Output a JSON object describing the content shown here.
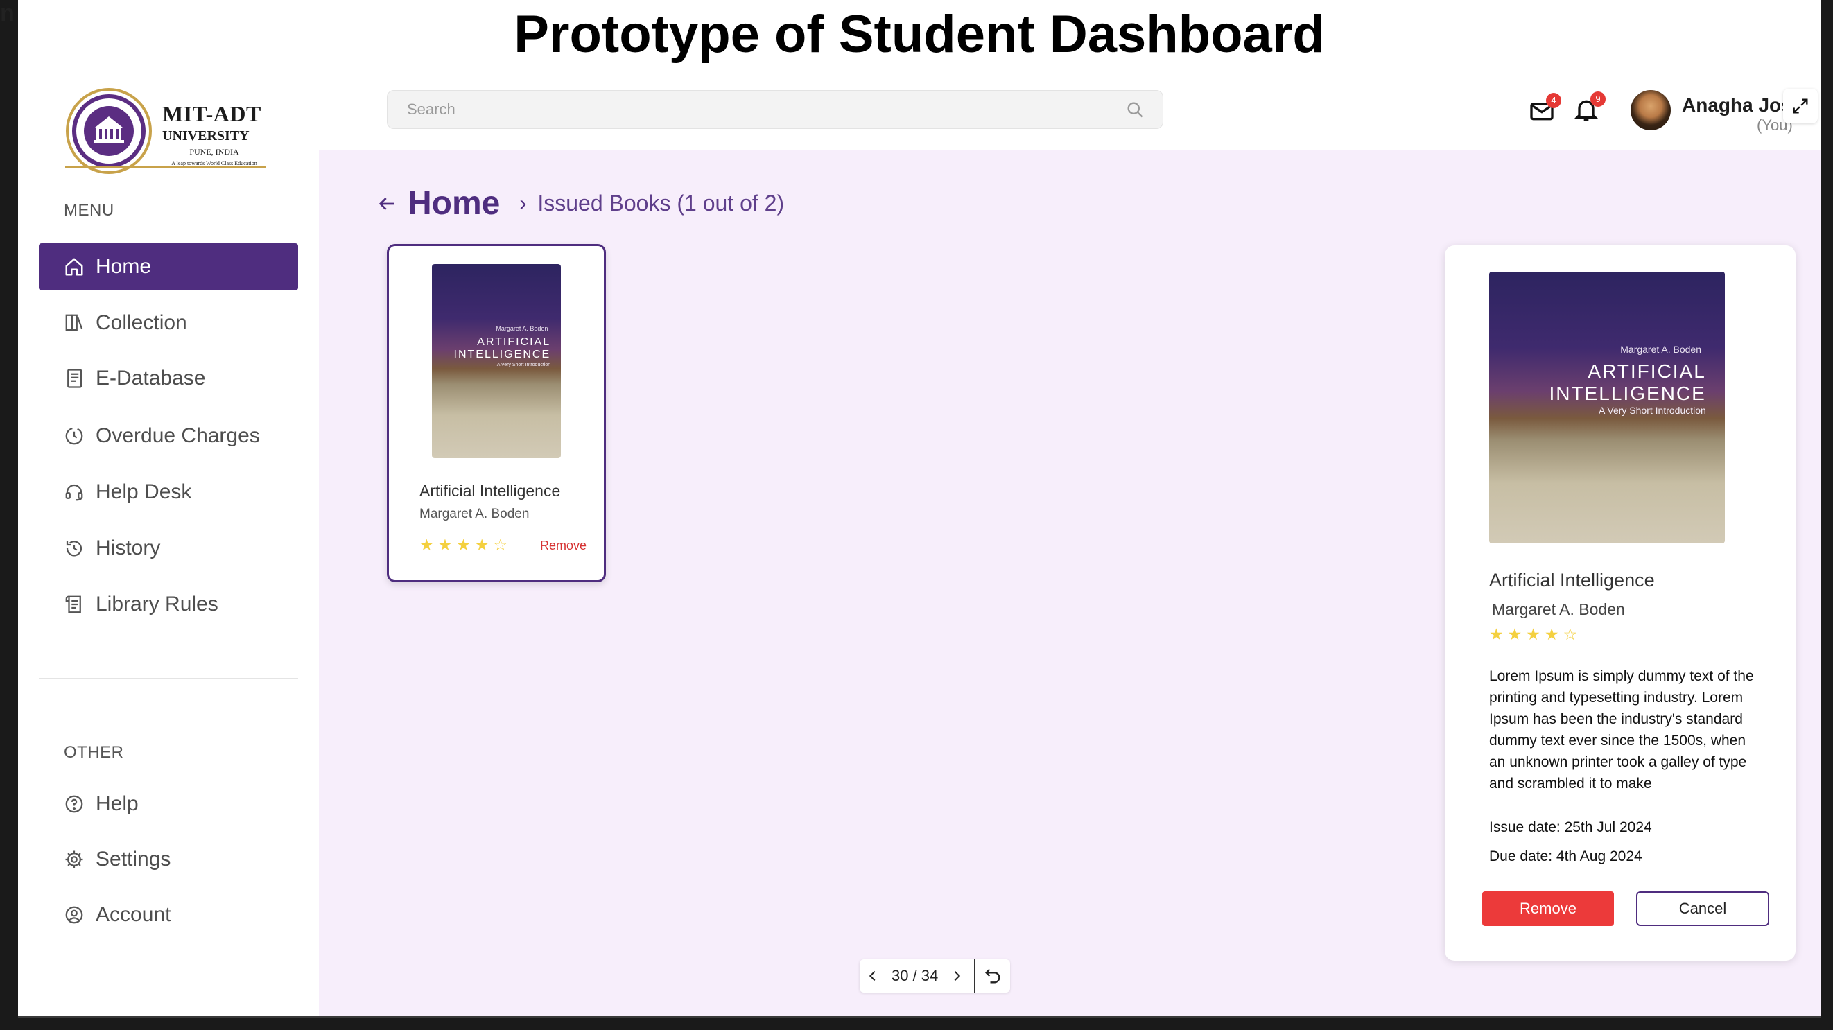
{
  "page_title": "Prototype of Student Dashboard",
  "logo": {
    "line1": "MIT-ADT",
    "line2": "UNIVERSITY",
    "line3": "PUNE, INDIA",
    "line4": "A leap towards World Class Education"
  },
  "sidebar": {
    "menu_label": "MENU",
    "items": [
      {
        "label": "Home",
        "icon": "home-icon",
        "active": true
      },
      {
        "label": "Collection",
        "icon": "collection-icon"
      },
      {
        "label": "E-Database",
        "icon": "book-icon"
      },
      {
        "label": "Overdue Charges",
        "icon": "clock-icon"
      },
      {
        "label": "Help Desk",
        "icon": "headset-icon"
      },
      {
        "label": "History",
        "icon": "history-icon"
      },
      {
        "label": "Library Rules",
        "icon": "rules-icon"
      }
    ],
    "other_label": "OTHER",
    "other_items": [
      {
        "label": "Help",
        "icon": "help-icon"
      },
      {
        "label": "Settings",
        "icon": "gear-icon"
      },
      {
        "label": "Account",
        "icon": "account-icon"
      }
    ]
  },
  "topbar": {
    "search_placeholder": "Search",
    "mail_count": "4",
    "notification_count": "9",
    "user_name": "Anagha Josl",
    "user_tag": "(You)"
  },
  "breadcrumb": {
    "home": "Home",
    "current": "Issued Books (1 out of 2)"
  },
  "book": {
    "title": "Artificial Intelligence",
    "author": "Margaret A. Boden",
    "rating": 4,
    "rating_max": 5,
    "remove_label": "Remove",
    "cover_author": "Margaret A. Boden",
    "cover_title_line1": "ARTIFICIAL",
    "cover_title_line2": "INTELLIGENCE",
    "cover_subtitle": "A Very Short Introduction"
  },
  "detail": {
    "title": "Artificial Intelligence",
    "author": "Margaret A. Boden",
    "description": "Lorem Ipsum is simply dummy text of the printing and typesetting industry. Lorem Ipsum has been the industry's standard dummy text ever since the 1500s, when an unknown printer took a galley of type and scrambled it to make",
    "issue_date": "Issue date: 25th Jul 2024",
    "due_date": "Due date: 4th Aug 2024",
    "remove_label": "Remove",
    "cancel_label": "Cancel"
  },
  "pager": {
    "text": "30 / 34"
  },
  "colors": {
    "primary": "#4f2d7f",
    "main_bg": "#f7eefb",
    "danger": "#ec3a3a",
    "star": "#f4d03f"
  }
}
